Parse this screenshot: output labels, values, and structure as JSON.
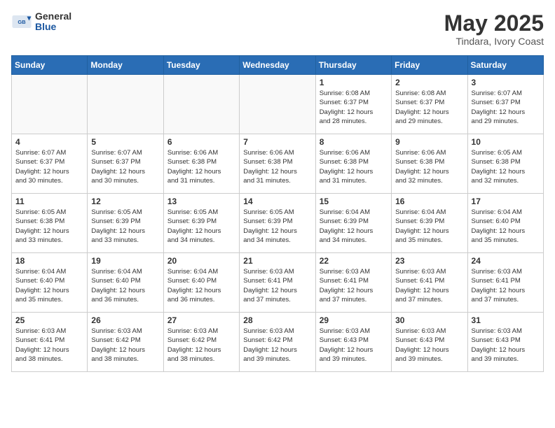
{
  "header": {
    "logo_general": "General",
    "logo_blue": "Blue",
    "month_year": "May 2025",
    "location": "Tindara, Ivory Coast"
  },
  "weekdays": [
    "Sunday",
    "Monday",
    "Tuesday",
    "Wednesday",
    "Thursday",
    "Friday",
    "Saturday"
  ],
  "weeks": [
    [
      {
        "day": "",
        "info": ""
      },
      {
        "day": "",
        "info": ""
      },
      {
        "day": "",
        "info": ""
      },
      {
        "day": "",
        "info": ""
      },
      {
        "day": "1",
        "info": "Sunrise: 6:08 AM\nSunset: 6:37 PM\nDaylight: 12 hours\nand 28 minutes."
      },
      {
        "day": "2",
        "info": "Sunrise: 6:08 AM\nSunset: 6:37 PM\nDaylight: 12 hours\nand 29 minutes."
      },
      {
        "day": "3",
        "info": "Sunrise: 6:07 AM\nSunset: 6:37 PM\nDaylight: 12 hours\nand 29 minutes."
      }
    ],
    [
      {
        "day": "4",
        "info": "Sunrise: 6:07 AM\nSunset: 6:37 PM\nDaylight: 12 hours\nand 30 minutes."
      },
      {
        "day": "5",
        "info": "Sunrise: 6:07 AM\nSunset: 6:37 PM\nDaylight: 12 hours\nand 30 minutes."
      },
      {
        "day": "6",
        "info": "Sunrise: 6:06 AM\nSunset: 6:38 PM\nDaylight: 12 hours\nand 31 minutes."
      },
      {
        "day": "7",
        "info": "Sunrise: 6:06 AM\nSunset: 6:38 PM\nDaylight: 12 hours\nand 31 minutes."
      },
      {
        "day": "8",
        "info": "Sunrise: 6:06 AM\nSunset: 6:38 PM\nDaylight: 12 hours\nand 31 minutes."
      },
      {
        "day": "9",
        "info": "Sunrise: 6:06 AM\nSunset: 6:38 PM\nDaylight: 12 hours\nand 32 minutes."
      },
      {
        "day": "10",
        "info": "Sunrise: 6:05 AM\nSunset: 6:38 PM\nDaylight: 12 hours\nand 32 minutes."
      }
    ],
    [
      {
        "day": "11",
        "info": "Sunrise: 6:05 AM\nSunset: 6:38 PM\nDaylight: 12 hours\nand 33 minutes."
      },
      {
        "day": "12",
        "info": "Sunrise: 6:05 AM\nSunset: 6:39 PM\nDaylight: 12 hours\nand 33 minutes."
      },
      {
        "day": "13",
        "info": "Sunrise: 6:05 AM\nSunset: 6:39 PM\nDaylight: 12 hours\nand 34 minutes."
      },
      {
        "day": "14",
        "info": "Sunrise: 6:05 AM\nSunset: 6:39 PM\nDaylight: 12 hours\nand 34 minutes."
      },
      {
        "day": "15",
        "info": "Sunrise: 6:04 AM\nSunset: 6:39 PM\nDaylight: 12 hours\nand 34 minutes."
      },
      {
        "day": "16",
        "info": "Sunrise: 6:04 AM\nSunset: 6:39 PM\nDaylight: 12 hours\nand 35 minutes."
      },
      {
        "day": "17",
        "info": "Sunrise: 6:04 AM\nSunset: 6:40 PM\nDaylight: 12 hours\nand 35 minutes."
      }
    ],
    [
      {
        "day": "18",
        "info": "Sunrise: 6:04 AM\nSunset: 6:40 PM\nDaylight: 12 hours\nand 35 minutes."
      },
      {
        "day": "19",
        "info": "Sunrise: 6:04 AM\nSunset: 6:40 PM\nDaylight: 12 hours\nand 36 minutes."
      },
      {
        "day": "20",
        "info": "Sunrise: 6:04 AM\nSunset: 6:40 PM\nDaylight: 12 hours\nand 36 minutes."
      },
      {
        "day": "21",
        "info": "Sunrise: 6:03 AM\nSunset: 6:41 PM\nDaylight: 12 hours\nand 37 minutes."
      },
      {
        "day": "22",
        "info": "Sunrise: 6:03 AM\nSunset: 6:41 PM\nDaylight: 12 hours\nand 37 minutes."
      },
      {
        "day": "23",
        "info": "Sunrise: 6:03 AM\nSunset: 6:41 PM\nDaylight: 12 hours\nand 37 minutes."
      },
      {
        "day": "24",
        "info": "Sunrise: 6:03 AM\nSunset: 6:41 PM\nDaylight: 12 hours\nand 37 minutes."
      }
    ],
    [
      {
        "day": "25",
        "info": "Sunrise: 6:03 AM\nSunset: 6:41 PM\nDaylight: 12 hours\nand 38 minutes."
      },
      {
        "day": "26",
        "info": "Sunrise: 6:03 AM\nSunset: 6:42 PM\nDaylight: 12 hours\nand 38 minutes."
      },
      {
        "day": "27",
        "info": "Sunrise: 6:03 AM\nSunset: 6:42 PM\nDaylight: 12 hours\nand 38 minutes."
      },
      {
        "day": "28",
        "info": "Sunrise: 6:03 AM\nSunset: 6:42 PM\nDaylight: 12 hours\nand 39 minutes."
      },
      {
        "day": "29",
        "info": "Sunrise: 6:03 AM\nSunset: 6:43 PM\nDaylight: 12 hours\nand 39 minutes."
      },
      {
        "day": "30",
        "info": "Sunrise: 6:03 AM\nSunset: 6:43 PM\nDaylight: 12 hours\nand 39 minutes."
      },
      {
        "day": "31",
        "info": "Sunrise: 6:03 AM\nSunset: 6:43 PM\nDaylight: 12 hours\nand 39 minutes."
      }
    ]
  ]
}
